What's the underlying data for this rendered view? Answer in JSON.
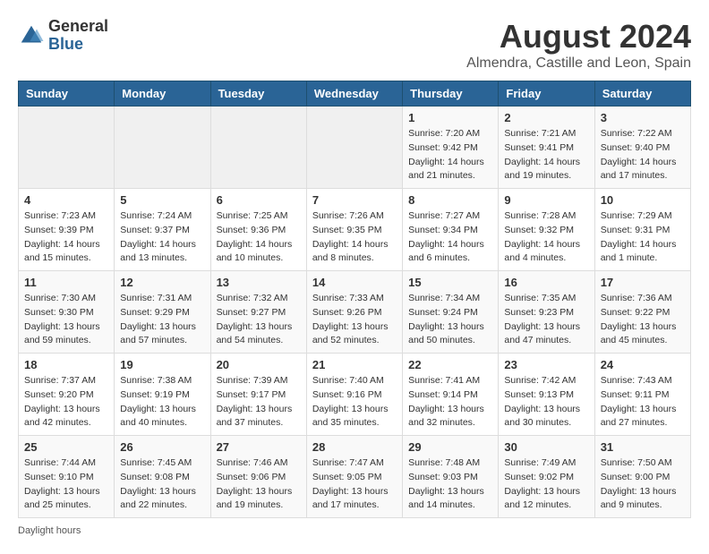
{
  "header": {
    "logo_general": "General",
    "logo_blue": "Blue",
    "month_title": "August 2024",
    "location": "Almendra, Castille and Leon, Spain"
  },
  "days_of_week": [
    "Sunday",
    "Monday",
    "Tuesday",
    "Wednesday",
    "Thursday",
    "Friday",
    "Saturday"
  ],
  "footer": {
    "daylight_note": "Daylight hours"
  },
  "weeks": [
    [
      {
        "day": "",
        "info": ""
      },
      {
        "day": "",
        "info": ""
      },
      {
        "day": "",
        "info": ""
      },
      {
        "day": "",
        "info": ""
      },
      {
        "day": "1",
        "info": "Sunrise: 7:20 AM\nSunset: 9:42 PM\nDaylight: 14 hours\nand 21 minutes."
      },
      {
        "day": "2",
        "info": "Sunrise: 7:21 AM\nSunset: 9:41 PM\nDaylight: 14 hours\nand 19 minutes."
      },
      {
        "day": "3",
        "info": "Sunrise: 7:22 AM\nSunset: 9:40 PM\nDaylight: 14 hours\nand 17 minutes."
      }
    ],
    [
      {
        "day": "4",
        "info": "Sunrise: 7:23 AM\nSunset: 9:39 PM\nDaylight: 14 hours\nand 15 minutes."
      },
      {
        "day": "5",
        "info": "Sunrise: 7:24 AM\nSunset: 9:37 PM\nDaylight: 14 hours\nand 13 minutes."
      },
      {
        "day": "6",
        "info": "Sunrise: 7:25 AM\nSunset: 9:36 PM\nDaylight: 14 hours\nand 10 minutes."
      },
      {
        "day": "7",
        "info": "Sunrise: 7:26 AM\nSunset: 9:35 PM\nDaylight: 14 hours\nand 8 minutes."
      },
      {
        "day": "8",
        "info": "Sunrise: 7:27 AM\nSunset: 9:34 PM\nDaylight: 14 hours\nand 6 minutes."
      },
      {
        "day": "9",
        "info": "Sunrise: 7:28 AM\nSunset: 9:32 PM\nDaylight: 14 hours\nand 4 minutes."
      },
      {
        "day": "10",
        "info": "Sunrise: 7:29 AM\nSunset: 9:31 PM\nDaylight: 14 hours\nand 1 minute."
      }
    ],
    [
      {
        "day": "11",
        "info": "Sunrise: 7:30 AM\nSunset: 9:30 PM\nDaylight: 13 hours\nand 59 minutes."
      },
      {
        "day": "12",
        "info": "Sunrise: 7:31 AM\nSunset: 9:29 PM\nDaylight: 13 hours\nand 57 minutes."
      },
      {
        "day": "13",
        "info": "Sunrise: 7:32 AM\nSunset: 9:27 PM\nDaylight: 13 hours\nand 54 minutes."
      },
      {
        "day": "14",
        "info": "Sunrise: 7:33 AM\nSunset: 9:26 PM\nDaylight: 13 hours\nand 52 minutes."
      },
      {
        "day": "15",
        "info": "Sunrise: 7:34 AM\nSunset: 9:24 PM\nDaylight: 13 hours\nand 50 minutes."
      },
      {
        "day": "16",
        "info": "Sunrise: 7:35 AM\nSunset: 9:23 PM\nDaylight: 13 hours\nand 47 minutes."
      },
      {
        "day": "17",
        "info": "Sunrise: 7:36 AM\nSunset: 9:22 PM\nDaylight: 13 hours\nand 45 minutes."
      }
    ],
    [
      {
        "day": "18",
        "info": "Sunrise: 7:37 AM\nSunset: 9:20 PM\nDaylight: 13 hours\nand 42 minutes."
      },
      {
        "day": "19",
        "info": "Sunrise: 7:38 AM\nSunset: 9:19 PM\nDaylight: 13 hours\nand 40 minutes."
      },
      {
        "day": "20",
        "info": "Sunrise: 7:39 AM\nSunset: 9:17 PM\nDaylight: 13 hours\nand 37 minutes."
      },
      {
        "day": "21",
        "info": "Sunrise: 7:40 AM\nSunset: 9:16 PM\nDaylight: 13 hours\nand 35 minutes."
      },
      {
        "day": "22",
        "info": "Sunrise: 7:41 AM\nSunset: 9:14 PM\nDaylight: 13 hours\nand 32 minutes."
      },
      {
        "day": "23",
        "info": "Sunrise: 7:42 AM\nSunset: 9:13 PM\nDaylight: 13 hours\nand 30 minutes."
      },
      {
        "day": "24",
        "info": "Sunrise: 7:43 AM\nSunset: 9:11 PM\nDaylight: 13 hours\nand 27 minutes."
      }
    ],
    [
      {
        "day": "25",
        "info": "Sunrise: 7:44 AM\nSunset: 9:10 PM\nDaylight: 13 hours\nand 25 minutes."
      },
      {
        "day": "26",
        "info": "Sunrise: 7:45 AM\nSunset: 9:08 PM\nDaylight: 13 hours\nand 22 minutes."
      },
      {
        "day": "27",
        "info": "Sunrise: 7:46 AM\nSunset: 9:06 PM\nDaylight: 13 hours\nand 19 minutes."
      },
      {
        "day": "28",
        "info": "Sunrise: 7:47 AM\nSunset: 9:05 PM\nDaylight: 13 hours\nand 17 minutes."
      },
      {
        "day": "29",
        "info": "Sunrise: 7:48 AM\nSunset: 9:03 PM\nDaylight: 13 hours\nand 14 minutes."
      },
      {
        "day": "30",
        "info": "Sunrise: 7:49 AM\nSunset: 9:02 PM\nDaylight: 13 hours\nand 12 minutes."
      },
      {
        "day": "31",
        "info": "Sunrise: 7:50 AM\nSunset: 9:00 PM\nDaylight: 13 hours\nand 9 minutes."
      }
    ]
  ]
}
